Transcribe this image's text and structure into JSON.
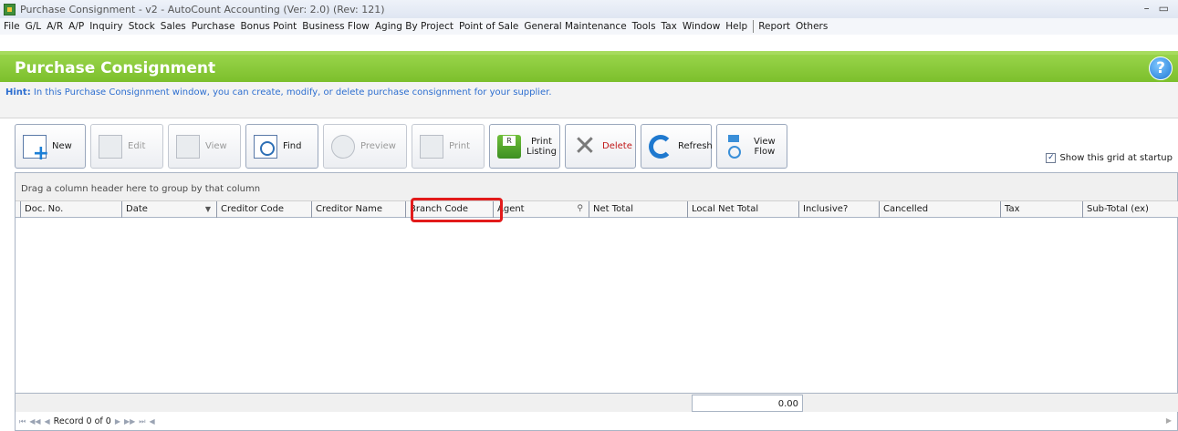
{
  "window": {
    "title": "Purchase Consignment - v2 - AutoCount Accounting (Ver: 2.0) (Rev: 121)",
    "controls": [
      "–",
      "▭"
    ]
  },
  "menu": {
    "items_left": [
      "File",
      "G/L",
      "A/R",
      "A/P",
      "Inquiry",
      "Stock",
      "Sales",
      "Purchase",
      "Bonus Point",
      "Business Flow",
      "Aging By Project",
      "Point of Sale",
      "General Maintenance",
      "Tools",
      "Tax",
      "Window",
      "Help"
    ],
    "items_right": [
      "Report",
      "Others"
    ]
  },
  "header": {
    "title": "Purchase Consignment",
    "help_glyph": "?"
  },
  "hint": {
    "label": "Hint:",
    "text": " In this Purchase Consignment window, you can create, modify, or delete purchase consignment for your supplier."
  },
  "toolbar": {
    "new": "New",
    "edit": "Edit",
    "view": "View",
    "find": "Find",
    "preview": "Preview",
    "print": "Print",
    "print_listing_1": "Print",
    "print_listing_2": "Listing",
    "delete": "Delete",
    "refresh": "Refresh",
    "view_flow_1": "View",
    "view_flow_2": "Flow"
  },
  "show_grid": {
    "label": "Show this grid at startup",
    "checked": true,
    "check_glyph": "✓"
  },
  "grid": {
    "group_hint": "Drag a column header here to group by that column",
    "columns": [
      "Doc. No.",
      "Date",
      "Creditor Code",
      "Creditor Name",
      "Branch Code",
      "Agent",
      "Net Total",
      "Local Net Total",
      "Inclusive?",
      "Cancelled",
      "Tax",
      "Sub-Total (ex)"
    ],
    "sort_glyph": "▼",
    "filter_glyph": "⚲",
    "footer_total": "0.00",
    "record_text": "Record 0 of 0",
    "nav_first": "⏮",
    "nav_prev_page": "◀◀",
    "nav_prev": "◀",
    "nav_next": "▶",
    "nav_next_page": "▶▶",
    "nav_last": "⏭",
    "nav_scroll_left": "◀",
    "nav_scroll_right": "▶"
  },
  "colors": {
    "header_green": "#7cbf2c",
    "hint_blue": "#2e6fd0",
    "highlight_red": "#e21b1b",
    "delete_red": "#c01818"
  }
}
